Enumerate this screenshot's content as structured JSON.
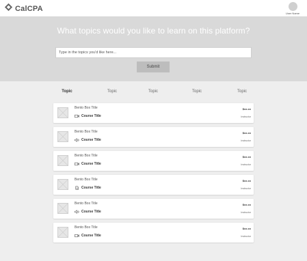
{
  "header": {
    "brand": "CalCPA",
    "user_name": "User Name",
    "logo_icon": "diamond-logo-icon",
    "avatar_icon": "user-avatar-icon"
  },
  "hero": {
    "title": "What topics would you like to learn on this platform?",
    "input_value": "",
    "input_placeholder": "Type in the topics you'd like here...",
    "submit_label": "Submit"
  },
  "tabs": [
    {
      "label": "Topic",
      "active": true
    },
    {
      "label": "Topic",
      "active": false
    },
    {
      "label": "Topic",
      "active": false
    },
    {
      "label": "Topic",
      "active": false
    },
    {
      "label": "Topic",
      "active": false
    }
  ],
  "cards": [
    {
      "bento_title": "Bento Box Title",
      "course_title": "Course Title",
      "price": "$xx.xx",
      "instructor": "Instructor",
      "icon": "video-camera-icon"
    },
    {
      "bento_title": "Bento Box Title",
      "course_title": "Course Title",
      "price": "$xx.xx",
      "instructor": "Instructor",
      "icon": "speaker-icon"
    },
    {
      "bento_title": "Bento Box Title",
      "course_title": "Course Title",
      "price": "$xx.xx",
      "instructor": "Instructor",
      "icon": "video-camera-icon"
    },
    {
      "bento_title": "Bento Box Title",
      "course_title": "Course Title",
      "price": "$xx.xx",
      "instructor": "Instructor",
      "icon": "document-icon"
    },
    {
      "bento_title": "Bento Box Title",
      "course_title": "Course Title",
      "price": "$xx.xx",
      "instructor": "Instructor",
      "icon": "speaker-icon"
    },
    {
      "bento_title": "Bento Box Title",
      "course_title": "Course Title",
      "price": "$xx.xx",
      "instructor": "Instructor",
      "icon": "video-camera-icon"
    }
  ],
  "colors": {
    "page_background": "#eeeeee",
    "hero_background": "#d9d9d9",
    "submit_button": "#bdbdbd",
    "card_background": "#ffffff"
  }
}
